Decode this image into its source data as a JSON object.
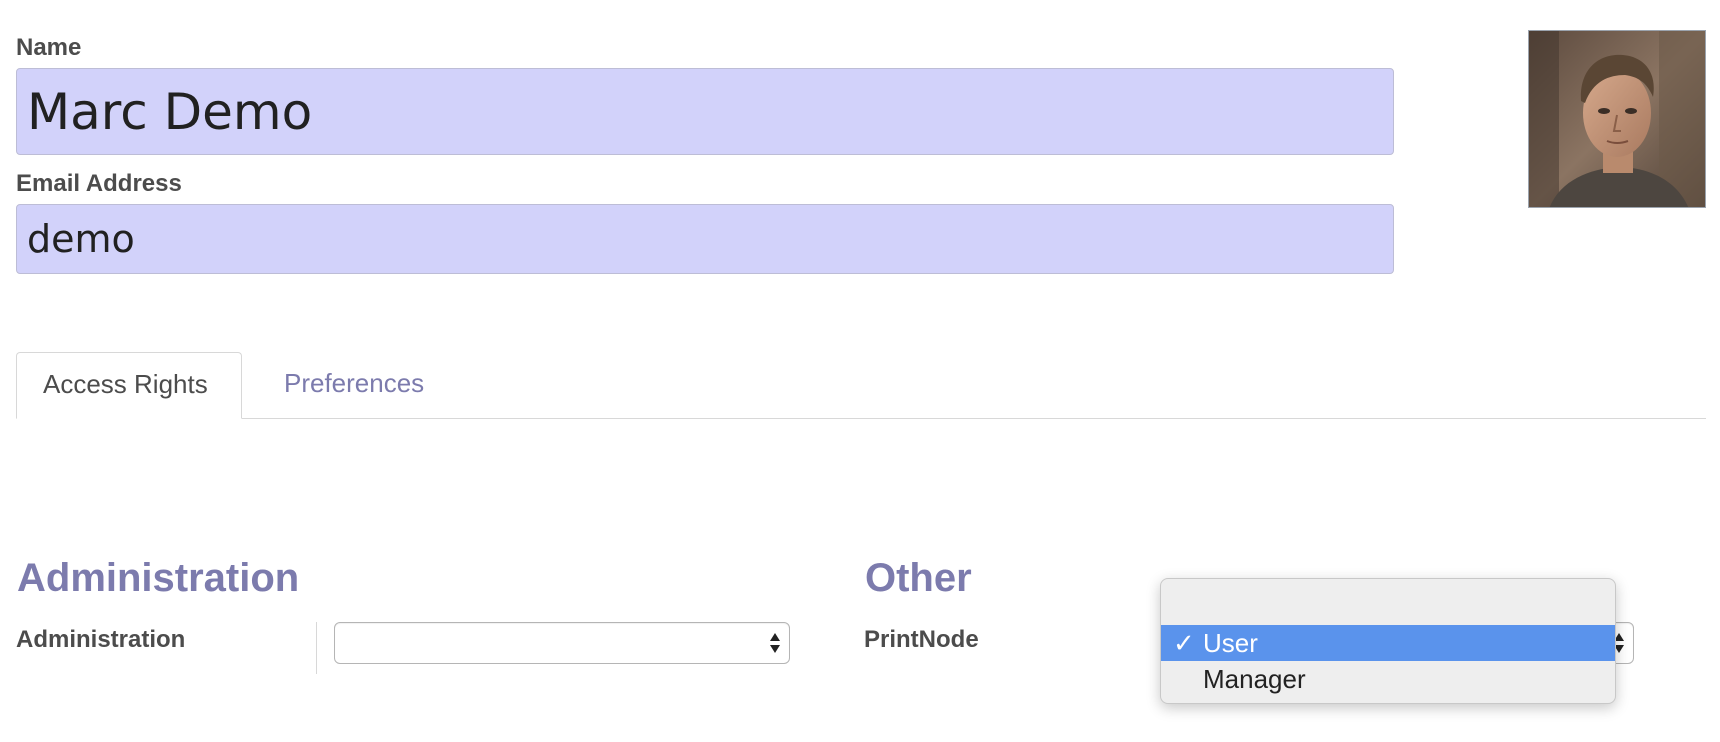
{
  "form": {
    "name_label": "Name",
    "name_value": "Marc Demo",
    "email_label": "Email Address",
    "email_value": "demo"
  },
  "tabs": [
    {
      "label": "Access Rights",
      "active": true
    },
    {
      "label": "Preferences",
      "active": false
    }
  ],
  "sections": {
    "administration": {
      "title": "Administration",
      "field_label": "Administration",
      "value": ""
    },
    "other": {
      "title": "Other",
      "field_label": "PrintNode",
      "value": "User"
    }
  },
  "dropdown": {
    "checkmark": "✓",
    "options": [
      "",
      "User",
      "Manager"
    ],
    "selected": "User"
  },
  "colors": {
    "accent": "#7c7bad",
    "input_background": "#d2d2fa",
    "menu_highlight": "#5a93ec"
  }
}
